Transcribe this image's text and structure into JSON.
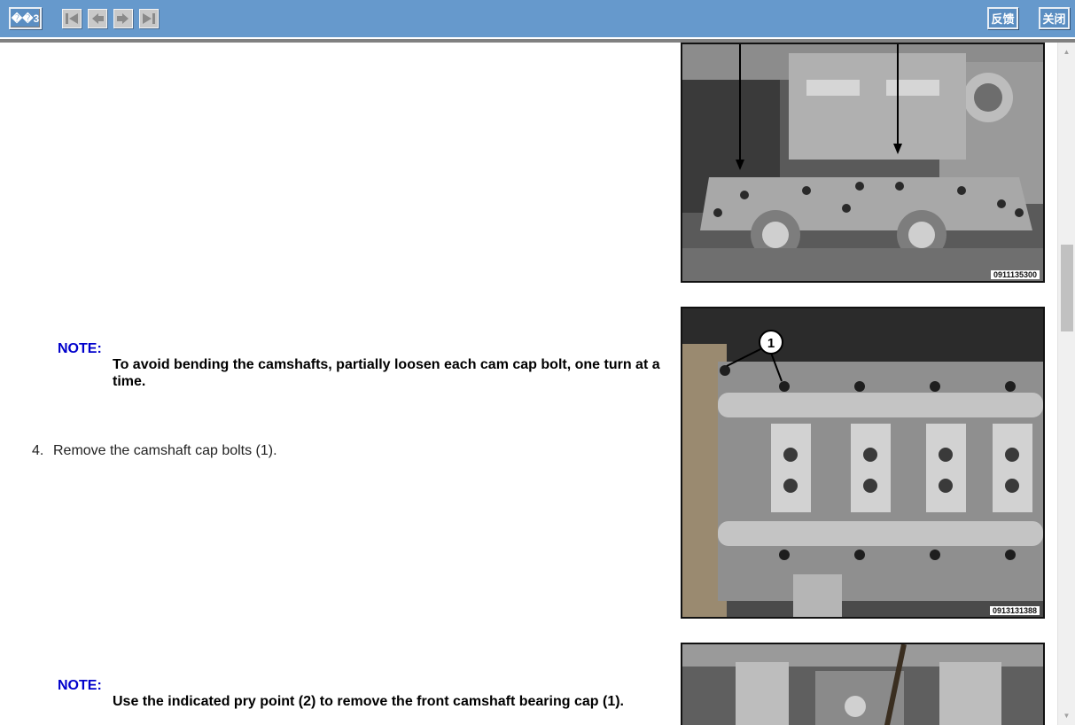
{
  "toolbar": {
    "home_label": "��3",
    "feedback_label": "反馈",
    "close_label": "关闭",
    "nav_icons": [
      "first-page-icon",
      "prev-page-icon",
      "next-page-icon",
      "last-page-icon"
    ],
    "bg_color": "#6699cc"
  },
  "content": {
    "note1": {
      "label": "NOTE:",
      "text": "To avoid bending the camshafts, partially loosen each cam cap bolt, one turn at a time."
    },
    "step4": {
      "number": "4.",
      "text": "Remove the camshaft cap bolts (1)."
    },
    "note2": {
      "label": "NOTE:",
      "text": "Use the indicated pry point (2) to remove the front camshaft bearing cap (1)."
    },
    "figures": [
      {
        "id": "0911135300"
      },
      {
        "id": "0913131388",
        "callout": "1"
      },
      {
        "id": ""
      }
    ]
  },
  "scrollbar": {
    "up_arrow": "▲",
    "down_arrow": "▼",
    "position_fraction": 0.35
  }
}
